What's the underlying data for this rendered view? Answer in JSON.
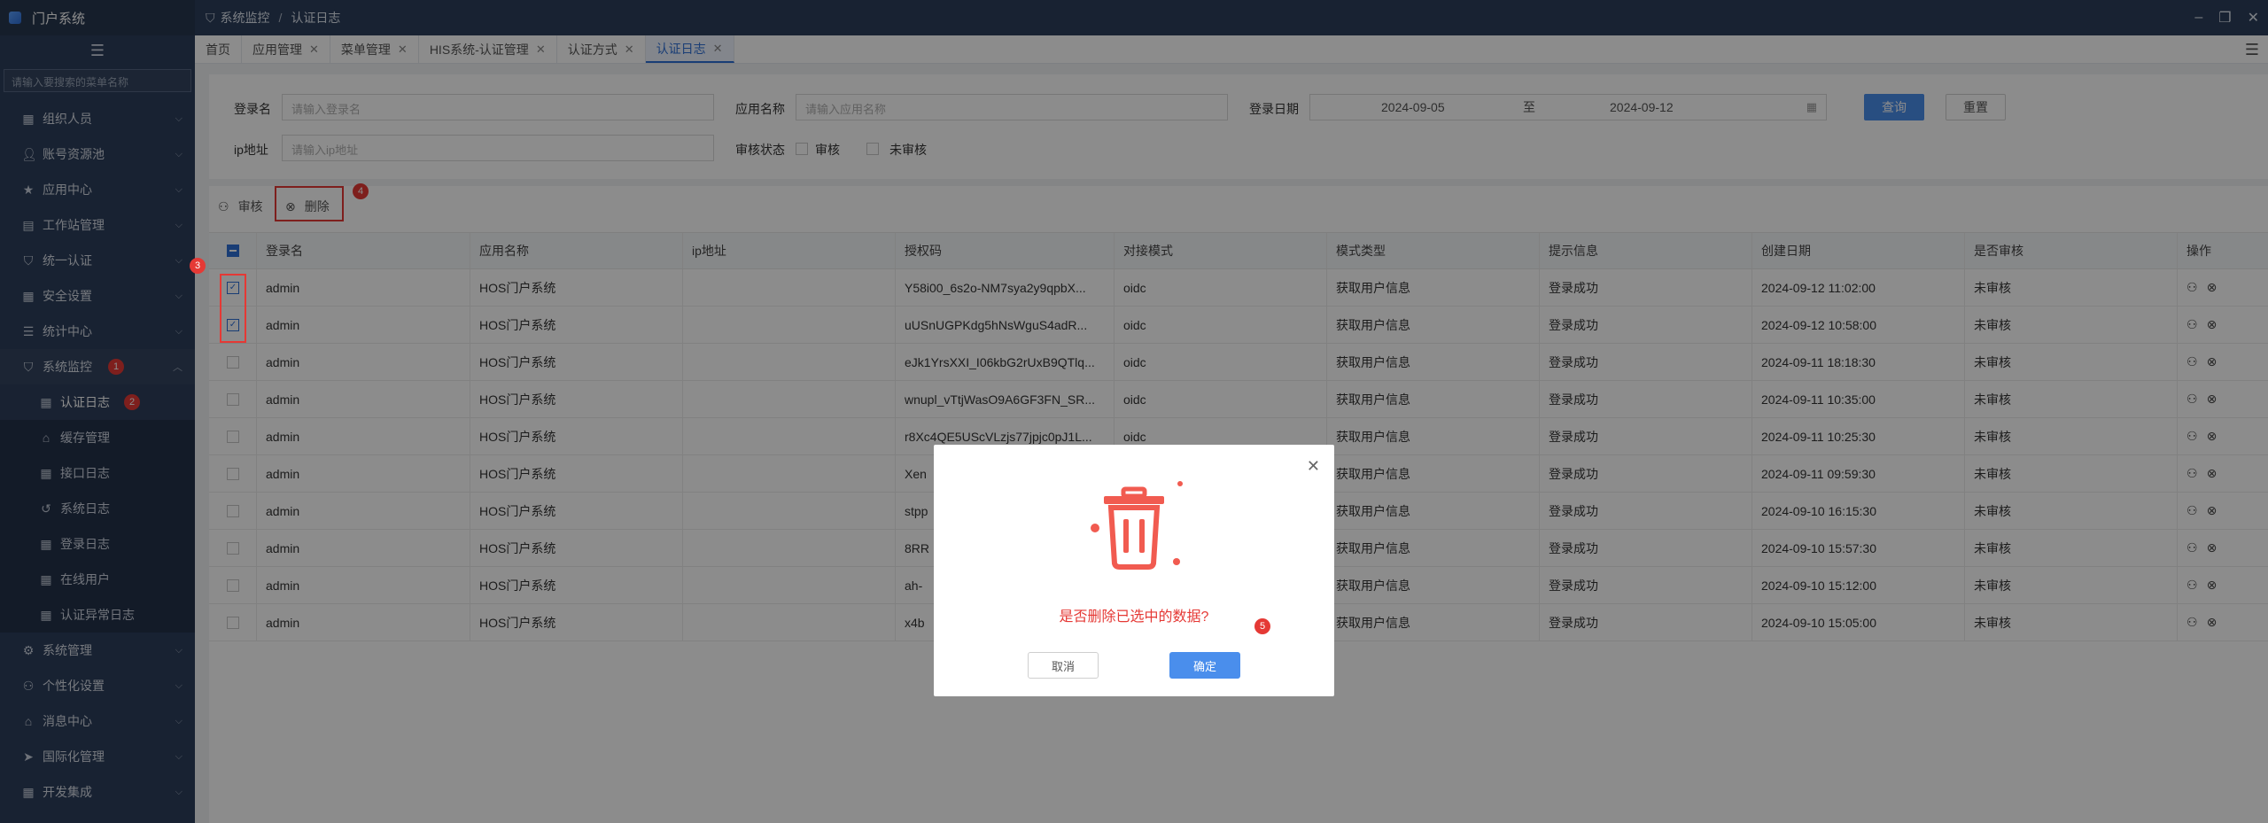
{
  "app": {
    "title": "门户系统"
  },
  "sidebar": {
    "search_placeholder": "请输入要搜索的菜单名称",
    "items": [
      {
        "label": "组织人员",
        "icon": "grid-icon"
      },
      {
        "label": "账号资源池",
        "icon": "user-icon"
      },
      {
        "label": "应用中心",
        "icon": "star-icon"
      },
      {
        "label": "工作站管理",
        "icon": "server-icon"
      },
      {
        "label": "统一认证",
        "icon": "shield-icon"
      },
      {
        "label": "安全设置",
        "icon": "grid-icon"
      },
      {
        "label": "统计中心",
        "icon": "list-icon"
      },
      {
        "label": "系统监控",
        "icon": "monitor-icon"
      }
    ],
    "submenu": [
      {
        "label": "认证日志",
        "icon": "grid-icon"
      },
      {
        "label": "缓存管理",
        "icon": "box-icon"
      },
      {
        "label": "接口日志",
        "icon": "grid-icon"
      },
      {
        "label": "系统日志",
        "icon": "history-icon"
      },
      {
        "label": "登录日志",
        "icon": "grid-icon"
      },
      {
        "label": "在线用户",
        "icon": "grid-icon"
      },
      {
        "label": "认证异常日志",
        "icon": "grid-icon"
      }
    ],
    "bottom_items": [
      {
        "label": "系统管理",
        "icon": "gear-icon"
      },
      {
        "label": "个性化设置",
        "icon": "user-cog-icon"
      },
      {
        "label": "消息中心",
        "icon": "home-icon"
      },
      {
        "label": "国际化管理",
        "icon": "send-icon"
      },
      {
        "label": "开发集成",
        "icon": "grid-icon"
      }
    ],
    "badges": {
      "monitor": "1",
      "auth_log": "2"
    }
  },
  "breadcrumb": {
    "parent": "系统监控",
    "current": "认证日志",
    "separator": "/"
  },
  "tabs": [
    {
      "label": "首页",
      "closable": false
    },
    {
      "label": "应用管理",
      "closable": true
    },
    {
      "label": "菜单管理",
      "closable": true
    },
    {
      "label": "HIS系统-认证管理",
      "closable": true
    },
    {
      "label": "认证方式",
      "closable": true
    },
    {
      "label": "认证日志",
      "closable": true
    }
  ],
  "filter": {
    "login_name_label": "登录名",
    "login_name_placeholder": "请输入登录名",
    "app_name_label": "应用名称",
    "app_name_placeholder": "请输入应用名称",
    "login_date_label": "登录日期",
    "date_start": "2024-09-05",
    "date_to": "至",
    "date_end": "2024-09-12",
    "ip_label": "ip地址",
    "ip_placeholder": "请输入ip地址",
    "audit_status_label": "审核状态",
    "audit_option_1": "审核",
    "audit_option_2": "未审核",
    "query_button": "查询",
    "reset_button": "重置"
  },
  "toolbar": {
    "audit_button": "审核",
    "delete_button": "删除",
    "badge_delete": "4",
    "badge_rows": "3"
  },
  "table": {
    "headers": [
      "登录名",
      "应用名称",
      "ip地址",
      "授权码",
      "对接模式",
      "模式类型",
      "提示信息",
      "创建日期",
      "是否审核",
      "操作"
    ],
    "rows": [
      {
        "login": "admin",
        "app": "HOS门户系统",
        "ip": "",
        "code": "Y58i00_6s2o-NM7sya2y9qpbX...",
        "mode": "oidc",
        "type": "获取用户信息",
        "tip": "登录成功",
        "date": "2024-09-12 11:02:00",
        "audit": "未审核",
        "checked": true
      },
      {
        "login": "admin",
        "app": "HOS门户系统",
        "ip": "",
        "code": "uUSnUGPKdg5hNsWguS4adR...",
        "mode": "oidc",
        "type": "获取用户信息",
        "tip": "登录成功",
        "date": "2024-09-12 10:58:00",
        "audit": "未审核",
        "checked": true
      },
      {
        "login": "admin",
        "app": "HOS门户系统",
        "ip": "",
        "code": "eJk1YrsXXI_I06kbG2rUxB9QTlq...",
        "mode": "oidc",
        "type": "获取用户信息",
        "tip": "登录成功",
        "date": "2024-09-11 18:18:30",
        "audit": "未审核",
        "checked": false
      },
      {
        "login": "admin",
        "app": "HOS门户系统",
        "ip": "",
        "code": "wnupl_vTtjWasO9A6GF3FN_SR...",
        "mode": "oidc",
        "type": "获取用户信息",
        "tip": "登录成功",
        "date": "2024-09-11 10:35:00",
        "audit": "未审核",
        "checked": false
      },
      {
        "login": "admin",
        "app": "HOS门户系统",
        "ip": "",
        "code": "r8Xc4QE5UScVLzjs77jpjc0pJ1L...",
        "mode": "oidc",
        "type": "获取用户信息",
        "tip": "登录成功",
        "date": "2024-09-11 10:25:30",
        "audit": "未审核",
        "checked": false
      },
      {
        "login": "admin",
        "app": "HOS门户系统",
        "ip": "",
        "code": "Xen",
        "mode": "",
        "type": "获取用户信息",
        "tip": "登录成功",
        "date": "2024-09-11 09:59:30",
        "audit": "未审核",
        "checked": false
      },
      {
        "login": "admin",
        "app": "HOS门户系统",
        "ip": "",
        "code": "stpp",
        "mode": "",
        "type": "获取用户信息",
        "tip": "登录成功",
        "date": "2024-09-10 16:15:30",
        "audit": "未审核",
        "checked": false
      },
      {
        "login": "admin",
        "app": "HOS门户系统",
        "ip": "",
        "code": "8RR",
        "mode": "",
        "type": "获取用户信息",
        "tip": "登录成功",
        "date": "2024-09-10 15:57:30",
        "audit": "未审核",
        "checked": false
      },
      {
        "login": "admin",
        "app": "HOS门户系统",
        "ip": "",
        "code": "ah-",
        "mode": "",
        "type": "获取用户信息",
        "tip": "登录成功",
        "date": "2024-09-10 15:12:00",
        "audit": "未审核",
        "checked": false
      },
      {
        "login": "admin",
        "app": "HOS门户系统",
        "ip": "",
        "code": "x4b",
        "mode": "",
        "type": "获取用户信息",
        "tip": "登录成功",
        "date": "2024-09-10 15:05:00",
        "audit": "未审核",
        "checked": false
      }
    ]
  },
  "modal": {
    "message": "是否删除已选中的数据?",
    "cancel": "取消",
    "confirm": "确定",
    "badge": "5",
    "icon": "trash-icon"
  },
  "colors": {
    "sidebar_bg": "#2c3e5c",
    "primary": "#4a8eec",
    "danger": "#e53935",
    "dialog_icon": "#f15b50"
  }
}
